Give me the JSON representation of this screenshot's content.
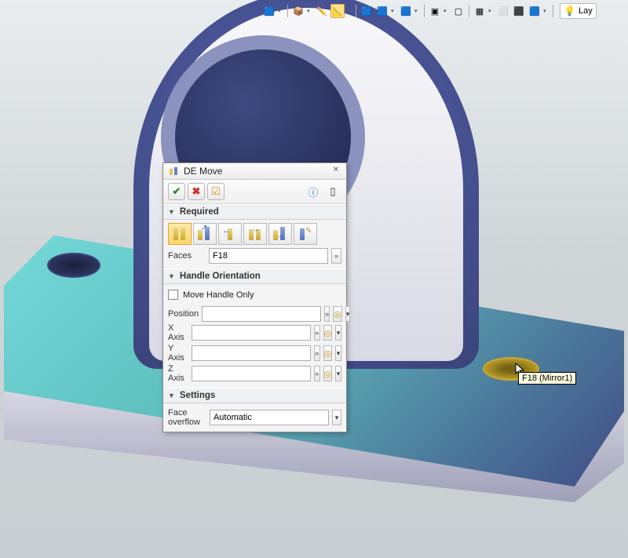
{
  "toolbar": {
    "layer_label": "Lay"
  },
  "dialog": {
    "title": "DE Move",
    "sections": {
      "required": "Required",
      "handle": "Handle Orientation",
      "settings": "Settings"
    },
    "faces_label": "Faces",
    "faces_value": "F18",
    "move_handle_only": "Move Handle Only",
    "fields": {
      "position": "Position",
      "x": "X Axis",
      "y": "Y Axis",
      "z": "Z Axis"
    },
    "overflow_label": "Face overflow",
    "overflow_value": "Automatic"
  },
  "tooltip": {
    "hole": "F18 (Mirror1)"
  },
  "icons": {
    "ok": "✔",
    "cancel": "✖",
    "options": "☑",
    "info": "ⓘ",
    "pin": "▯",
    "close": "✕",
    "dropdown": "▾",
    "collapse": "▼",
    "target": "◎",
    "more": "»"
  }
}
